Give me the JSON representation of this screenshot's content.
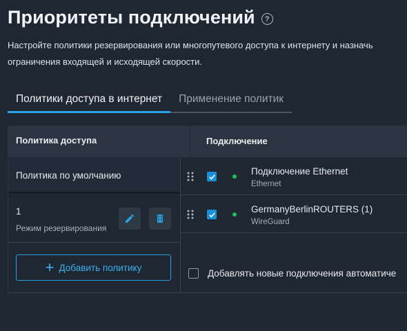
{
  "page": {
    "title": "Приоритеты подключений",
    "help_icon": "question-circle-icon",
    "description_line1": "Настройте политики резервирования или многопутевого доступа к интернету и назначь",
    "description_line2": "ограничения входящей и исходящей скорости."
  },
  "tabs": [
    {
      "label": "Политики доступа в интернет",
      "active": true
    },
    {
      "label": "Применение политик",
      "active": false
    }
  ],
  "table": {
    "col_policy": "Политика доступа",
    "col_connection": "Подключение"
  },
  "policies": [
    {
      "name": "Политика по умолчанию"
    },
    {
      "name": "1",
      "mode": "Режим резервирования",
      "edit_icon": "pencil-icon",
      "delete_icon": "trash-icon"
    }
  ],
  "add_button": {
    "label": "Добавить политику",
    "icon": "plus-icon"
  },
  "connections": [
    {
      "name": "Подключение Ethernet",
      "type": "Ethernet",
      "checked": true,
      "status": "online"
    },
    {
      "name": "GermanyBerlinROUTERS (1)",
      "type": "WireGuard",
      "checked": true,
      "status": "online"
    }
  ],
  "auto_add": {
    "label": "Добавлять новые подключения автоматиче",
    "checked": false
  },
  "colors": {
    "background": "#1f2733",
    "accent": "#2aa4e8",
    "checkbox": "#1a8fd6",
    "online": "#1fbf5a"
  }
}
